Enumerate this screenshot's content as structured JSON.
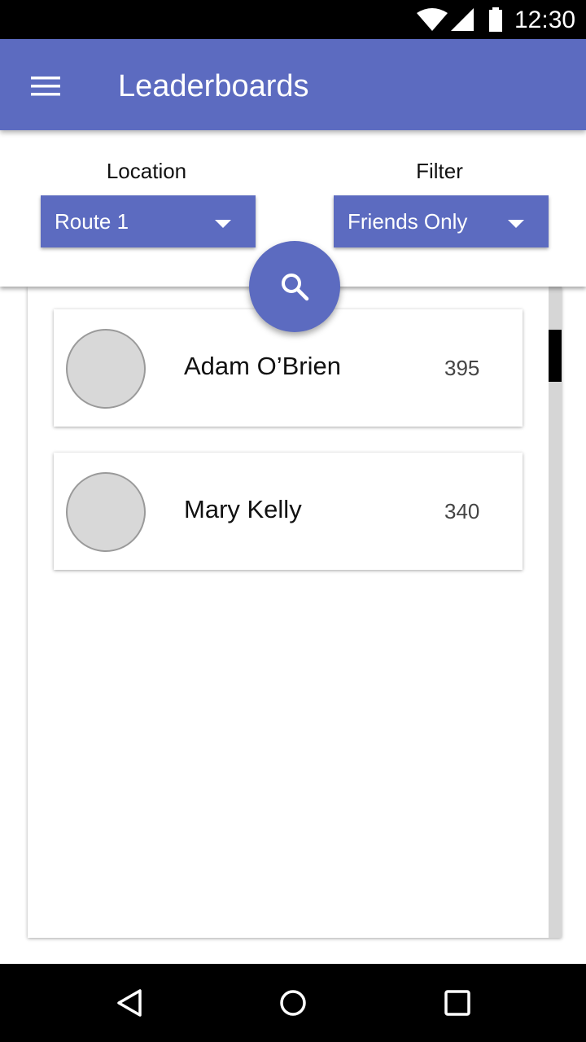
{
  "status_bar": {
    "time": "12:30",
    "icons": [
      "wifi-icon",
      "signal-icon",
      "battery-icon"
    ]
  },
  "app_bar": {
    "title": "Leaderboards",
    "menu_icon": "menu-icon"
  },
  "filters": {
    "location": {
      "label": "Location",
      "value": "Route 1"
    },
    "filter": {
      "label": "Filter",
      "value": "Friends Only"
    },
    "search_icon": "search-icon"
  },
  "leaderboard": {
    "entries": [
      {
        "name": "Adam O’Brien",
        "score": "395"
      },
      {
        "name": "Mary Kelly",
        "score": "340"
      }
    ]
  },
  "nav_bar": {
    "icons": [
      "back-icon",
      "home-icon",
      "recents-icon"
    ]
  },
  "colors": {
    "primary": "#5c6bc0",
    "avatar_fill": "#d8d8d8",
    "scroll_track": "#d6d6d6"
  }
}
